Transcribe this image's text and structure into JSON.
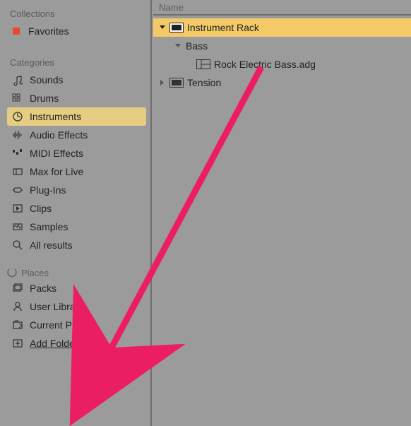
{
  "sidebar": {
    "collections_header": "Collections",
    "favorites": "Favorites",
    "categories_header": "Categories",
    "categories": [
      {
        "label": "Sounds"
      },
      {
        "label": "Drums"
      },
      {
        "label": "Instruments",
        "selected": true
      },
      {
        "label": "Audio Effects"
      },
      {
        "label": "MIDI Effects"
      },
      {
        "label": "Max for Live"
      },
      {
        "label": "Plug-Ins"
      },
      {
        "label": "Clips"
      },
      {
        "label": "Samples"
      },
      {
        "label": "All results"
      }
    ],
    "places_header": "Places",
    "places": [
      {
        "label": "Packs"
      },
      {
        "label": "User Library"
      },
      {
        "label": "Current Project"
      },
      {
        "label": "Add Folder...",
        "underline": true
      }
    ]
  },
  "content": {
    "name_header": "Name",
    "tree": {
      "instrument_rack": "Instrument Rack",
      "bass": "Bass",
      "rock_bass": "Rock Electric Bass.adg",
      "tension": "Tension"
    }
  }
}
